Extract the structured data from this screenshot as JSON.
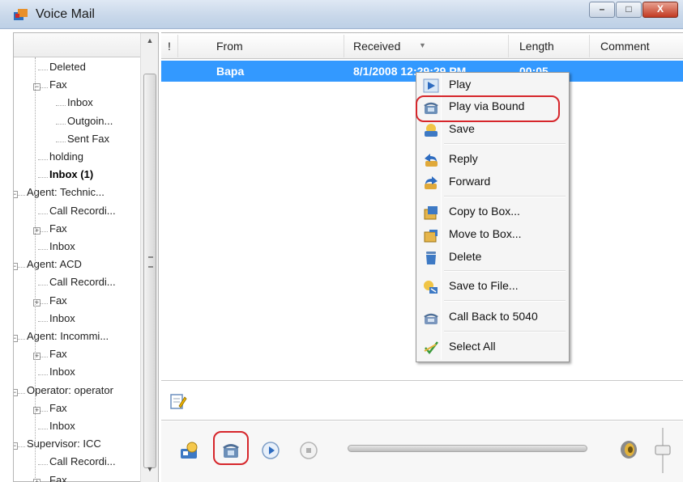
{
  "window": {
    "title": "Voice Mail",
    "buttons": {
      "minimize": "–",
      "maximize": "□",
      "close": "X"
    }
  },
  "tree": {
    "items": [
      {
        "label": "Deleted",
        "level": 2,
        "bold": false
      },
      {
        "label": "Fax",
        "level": 2,
        "bold": false,
        "expander": "-"
      },
      {
        "label": "Inbox",
        "level": 3,
        "bold": false
      },
      {
        "label": "Outgoin...",
        "level": 3,
        "bold": false
      },
      {
        "label": "Sent Fax",
        "level": 3,
        "bold": false
      },
      {
        "label": "holding",
        "level": 2,
        "bold": false
      },
      {
        "label": "Inbox (1)",
        "level": 2,
        "bold": true
      },
      {
        "label": "Agent: Technic...",
        "level": 1,
        "bold": false,
        "expander": "-"
      },
      {
        "label": "Call Recordi...",
        "level": 2,
        "bold": false
      },
      {
        "label": "Fax",
        "level": 2,
        "bold": false,
        "expander": "+"
      },
      {
        "label": "Inbox",
        "level": 2,
        "bold": false
      },
      {
        "label": "Agent: ACD",
        "level": 1,
        "bold": false,
        "expander": "-"
      },
      {
        "label": "Call Recordi...",
        "level": 2,
        "bold": false
      },
      {
        "label": "Fax",
        "level": 2,
        "bold": false,
        "expander": "+"
      },
      {
        "label": "Inbox",
        "level": 2,
        "bold": false
      },
      {
        "label": "Agent: Incommi...",
        "level": 1,
        "bold": false,
        "expander": "-"
      },
      {
        "label": "Fax",
        "level": 2,
        "bold": false,
        "expander": "+"
      },
      {
        "label": "Inbox",
        "level": 2,
        "bold": false
      },
      {
        "label": "Operator: operator",
        "level": 1,
        "bold": false,
        "expander": "-"
      },
      {
        "label": "Fax",
        "level": 2,
        "bold": false,
        "expander": "+"
      },
      {
        "label": "Inbox",
        "level": 2,
        "bold": false
      },
      {
        "label": "Supervisor: ICC",
        "level": 1,
        "bold": false,
        "expander": "-"
      },
      {
        "label": "Call Recordi...",
        "level": 2,
        "bold": false
      },
      {
        "label": "Fax",
        "level": 2,
        "bold": false,
        "expander": "+"
      }
    ]
  },
  "list": {
    "columns": [
      "!",
      "From",
      "Received",
      "Length",
      "Comment"
    ],
    "rows": [
      {
        "from": "Bapa",
        "received": "8/1/2008 12:29:29 PM",
        "length": "00:05",
        "comment": ""
      }
    ]
  },
  "context_menu": {
    "items": [
      {
        "label": "Play",
        "icon": "play-icon"
      },
      {
        "label": "Play via Bound",
        "icon": "phone-play-icon",
        "highlighted": true
      },
      {
        "label": "Save",
        "icon": "save-icon"
      },
      {
        "label": "Reply",
        "icon": "reply-icon"
      },
      {
        "label": "Forward",
        "icon": "forward-icon"
      },
      {
        "label": "Copy to Box...",
        "icon": "copy-to-box-icon"
      },
      {
        "label": "Move to Box...",
        "icon": "move-to-box-icon"
      },
      {
        "label": "Delete",
        "icon": "delete-icon"
      },
      {
        "label": "Save to File...",
        "icon": "save-to-file-icon"
      },
      {
        "label": "Call Back to 5040",
        "icon": "call-back-icon"
      },
      {
        "label": "Select All",
        "icon": "select-all-icon"
      }
    ]
  },
  "toolbar": {
    "icons": [
      "voicemail-box-icon",
      "phone-play-icon",
      "play-icon",
      "stop-icon",
      "volume-icon"
    ],
    "highlighted_icon": "phone-play-icon"
  },
  "colors": {
    "selection": "#3399ff",
    "highlight_ring": "#d6262b",
    "titlebar": "#c9d8ea"
  }
}
